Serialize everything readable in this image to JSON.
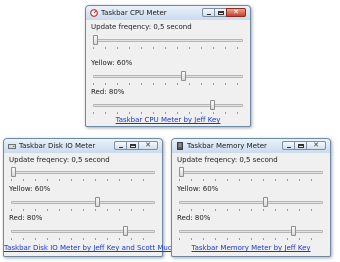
{
  "windows": [
    {
      "id": "cpu",
      "title": "Taskbar CPU Meter",
      "icon": "cpu-meter-icon",
      "close_active": true,
      "update": {
        "label": "Update freqency: 0,5 second",
        "value": 0.0
      },
      "yellow": {
        "label": "Yellow: 60%",
        "value": 0.6
      },
      "red": {
        "label": "Red: 80%",
        "value": 0.8
      },
      "link": "Taskbar CPU Meter by Jeff Key"
    },
    {
      "id": "disk",
      "title": "Taskbar Disk IO Meter",
      "icon": "disk-meter-icon",
      "close_active": false,
      "update": {
        "label": "Update freqency: 0,5 second",
        "value": 0.0
      },
      "yellow": {
        "label": "Yellow: 60%",
        "value": 0.6
      },
      "red": {
        "label": "Red: 80%",
        "value": 0.8
      },
      "link": "Taskbar Disk IO Meter by Jeff Key and Scott Muc"
    },
    {
      "id": "memory",
      "title": "Taskbar Memory Meter",
      "icon": "memory-meter-icon",
      "close_active": false,
      "update": {
        "label": "Update freqency: 0,5 second",
        "value": 0.0
      },
      "yellow": {
        "label": "Yellow: 60%",
        "value": 0.6
      },
      "red": {
        "label": "Red: 80%",
        "value": 0.8
      },
      "link": "Taskbar Memory Meter by Jeff Key"
    }
  ],
  "colors": {
    "link": "#1a35d6",
    "close_active": "#c7422a",
    "window_bg": "#f0f0f0"
  }
}
